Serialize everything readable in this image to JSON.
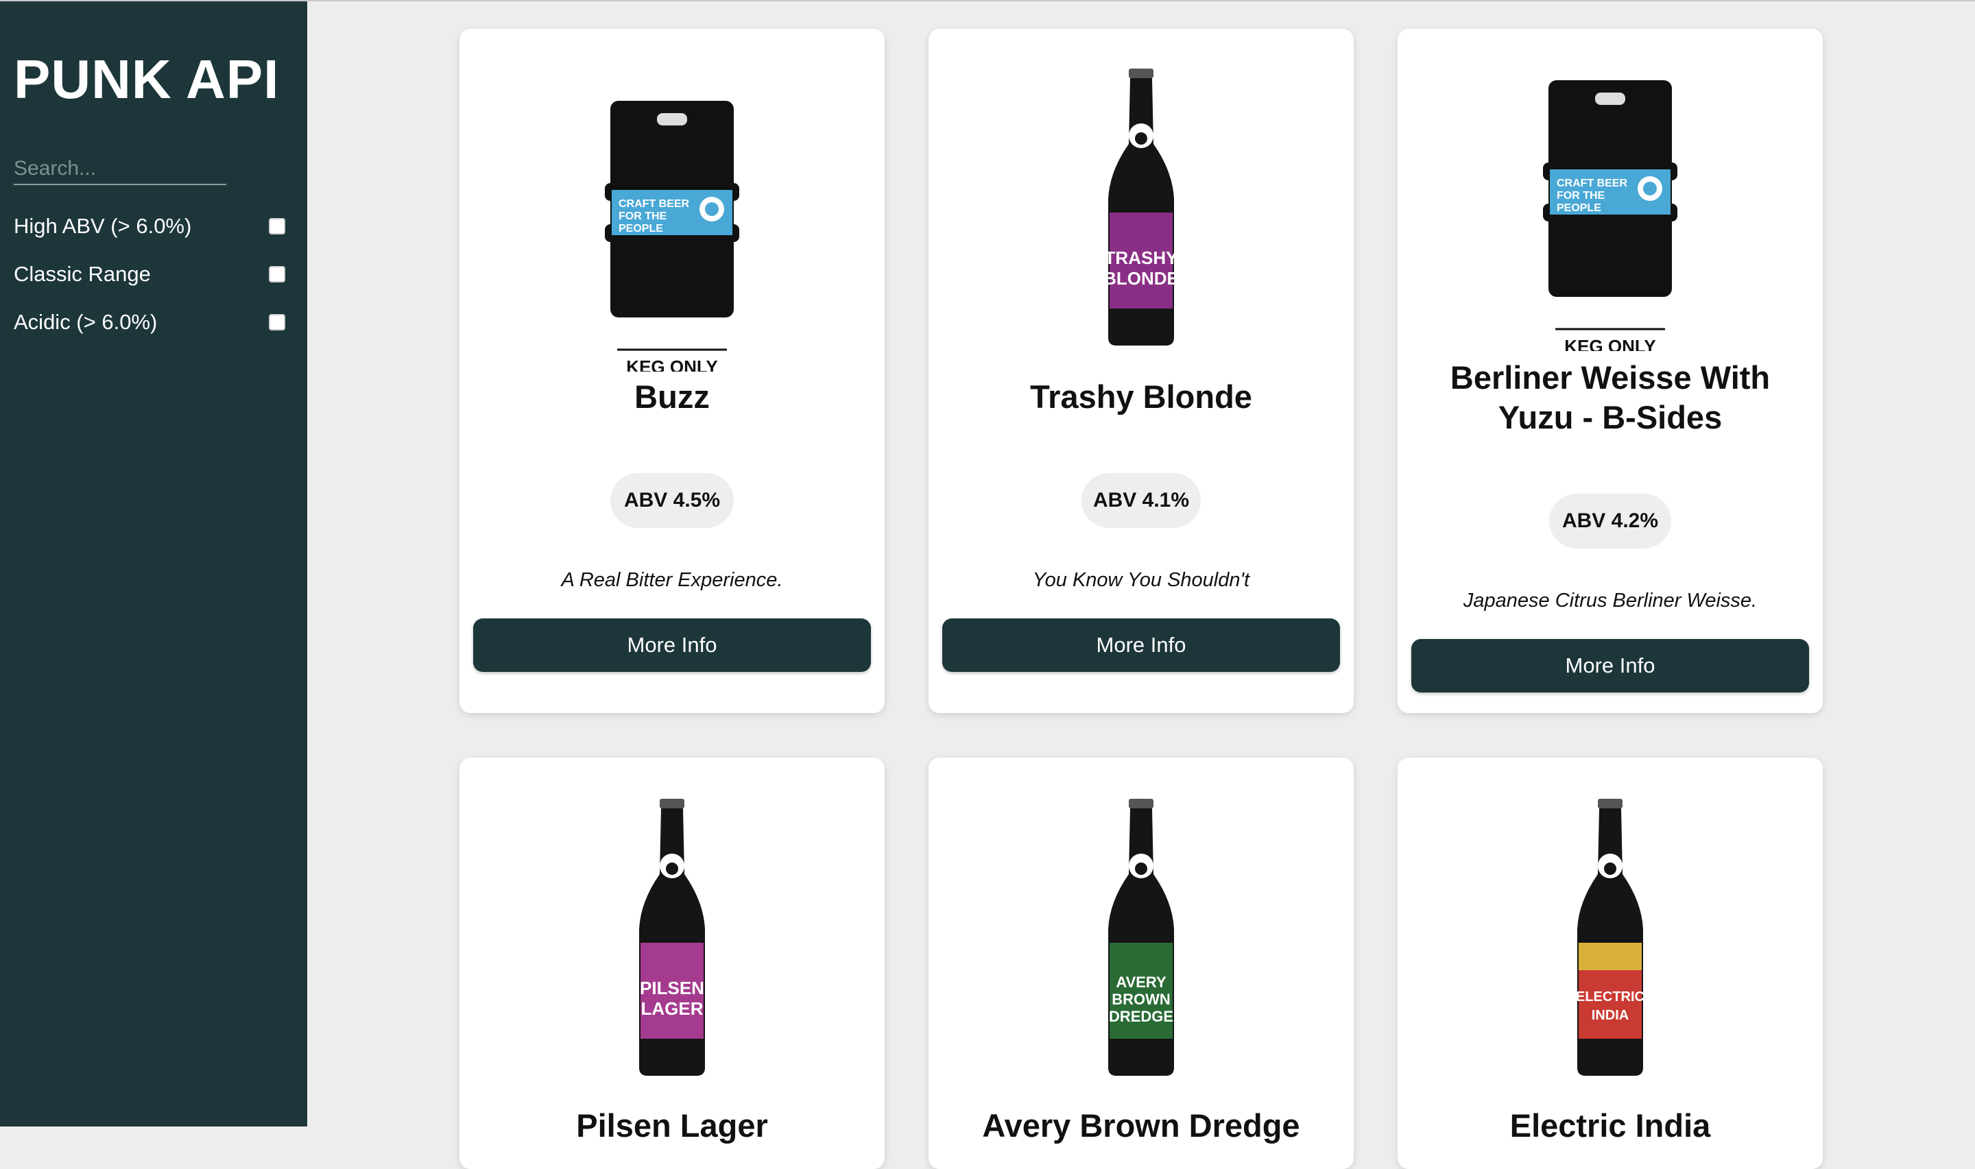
{
  "app": {
    "title": "PUNK API"
  },
  "search": {
    "placeholder": "Search..."
  },
  "filters": [
    {
      "label": "High ABV (> 6.0%)",
      "checked": false
    },
    {
      "label": "Classic Range",
      "checked": false
    },
    {
      "label": "Acidic (> 6.0%)",
      "checked": false
    }
  ],
  "keg_label": "KEG ONLY",
  "beers": [
    {
      "name": "Buzz",
      "abv": "ABV 4.5%",
      "tagline": "A Real Bitter Experience.",
      "button": "More Info",
      "image": "keg"
    },
    {
      "name": "Trashy Blonde",
      "abv": "ABV 4.1%",
      "tagline": "You Know You Shouldn't",
      "button": "More Info",
      "image": "bottle",
      "label_color": "#8a2f86"
    },
    {
      "name": "Berliner Weisse With Yuzu - B-Sides",
      "abv": "ABV 4.2%",
      "tagline": "Japanese Citrus Berliner Weisse.",
      "button": "More Info",
      "image": "keg"
    },
    {
      "name": "Pilsen Lager",
      "image": "bottle",
      "label_color": "#a53b8f"
    },
    {
      "name": "Avery Brown Dredge",
      "image": "bottle",
      "label_color": "#2a6b35"
    },
    {
      "name": "Electric India",
      "image": "bottle",
      "label_color": "#c93a32"
    }
  ],
  "colors": {
    "sidebar": "#1d363a",
    "background": "#eeeced",
    "keg_band": "#4aa8d6"
  }
}
